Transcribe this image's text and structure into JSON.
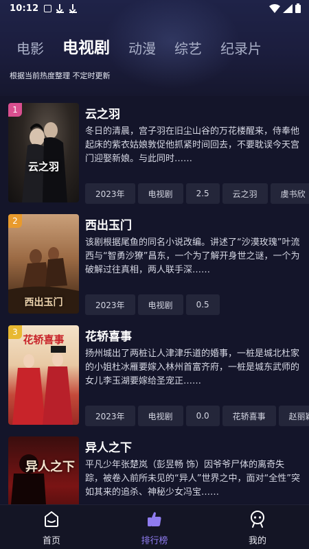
{
  "status_bar": {
    "time": "10:12"
  },
  "tabs": [
    {
      "label": "电影",
      "active": false
    },
    {
      "label": "电视剧",
      "active": true
    },
    {
      "label": "动漫",
      "active": false
    },
    {
      "label": "综艺",
      "active": false
    },
    {
      "label": "纪录片",
      "active": false
    }
  ],
  "subtitle": "根据当前热度整理 不定时更新",
  "items": [
    {
      "rank": "1",
      "rank_color": "#d94f8f",
      "poster_text": "云之羽",
      "title": "云之羽",
      "desc": "冬日的清晨，宫子羽在旧尘山谷的万花楼醒来，侍奉他起床的紫衣姑娘敦促他抓紧时间回去，不要耽误今天宫门迎娶新娘。与此同时……",
      "tags": [
        "2023年",
        "电视剧",
        "2.5",
        "云之羽",
        "虞书欣"
      ]
    },
    {
      "rank": "2",
      "rank_color": "#e89a2d",
      "poster_text": "西出玉门",
      "title": "西出玉门",
      "desc": "该剧根据尾鱼的同名小说改编。讲述了“沙漠玫瑰”叶流西与“智勇沙獠”昌东，一个为了解开身世之谜，一个为破解过往真相，两人联手深……",
      "tags": [
        "2023年",
        "电视剧",
        "0.5"
      ]
    },
    {
      "rank": "3",
      "rank_color": "#e8b832",
      "poster_text": "花轿喜事",
      "title": "花轿喜事",
      "desc": "扬州城出了两桩让人津津乐道的婚事，一桩是城北杜家的小姐杜冰雁要嫁入林州首富齐府，一桩是城东武师的女儿李玉湖要嫁给圣宠正……",
      "tags": [
        "2023年",
        "电视剧",
        "0.0",
        "花轿喜事",
        "赵丽颖"
      ]
    },
    {
      "rank": "",
      "rank_color": "",
      "poster_text": "异人之下",
      "title": "异人之下",
      "desc": "平凡少年张楚岚（彭昱畅 饰）因爷爷尸体的离奇失踪，被卷入前所未见的“异人”世界之中，面对“全性”突如其来的追杀、神秘少女冯宝……",
      "tags": []
    }
  ],
  "bottom_nav": [
    {
      "label": "首页",
      "icon": "home-icon",
      "active": false
    },
    {
      "label": "排行榜",
      "icon": "ranking-icon",
      "active": true
    },
    {
      "label": "我的",
      "icon": "profile-icon",
      "active": false
    }
  ],
  "colors": {
    "accent": "#8f7cf0",
    "background": "#14152a",
    "tag_bg": "#24263a"
  }
}
